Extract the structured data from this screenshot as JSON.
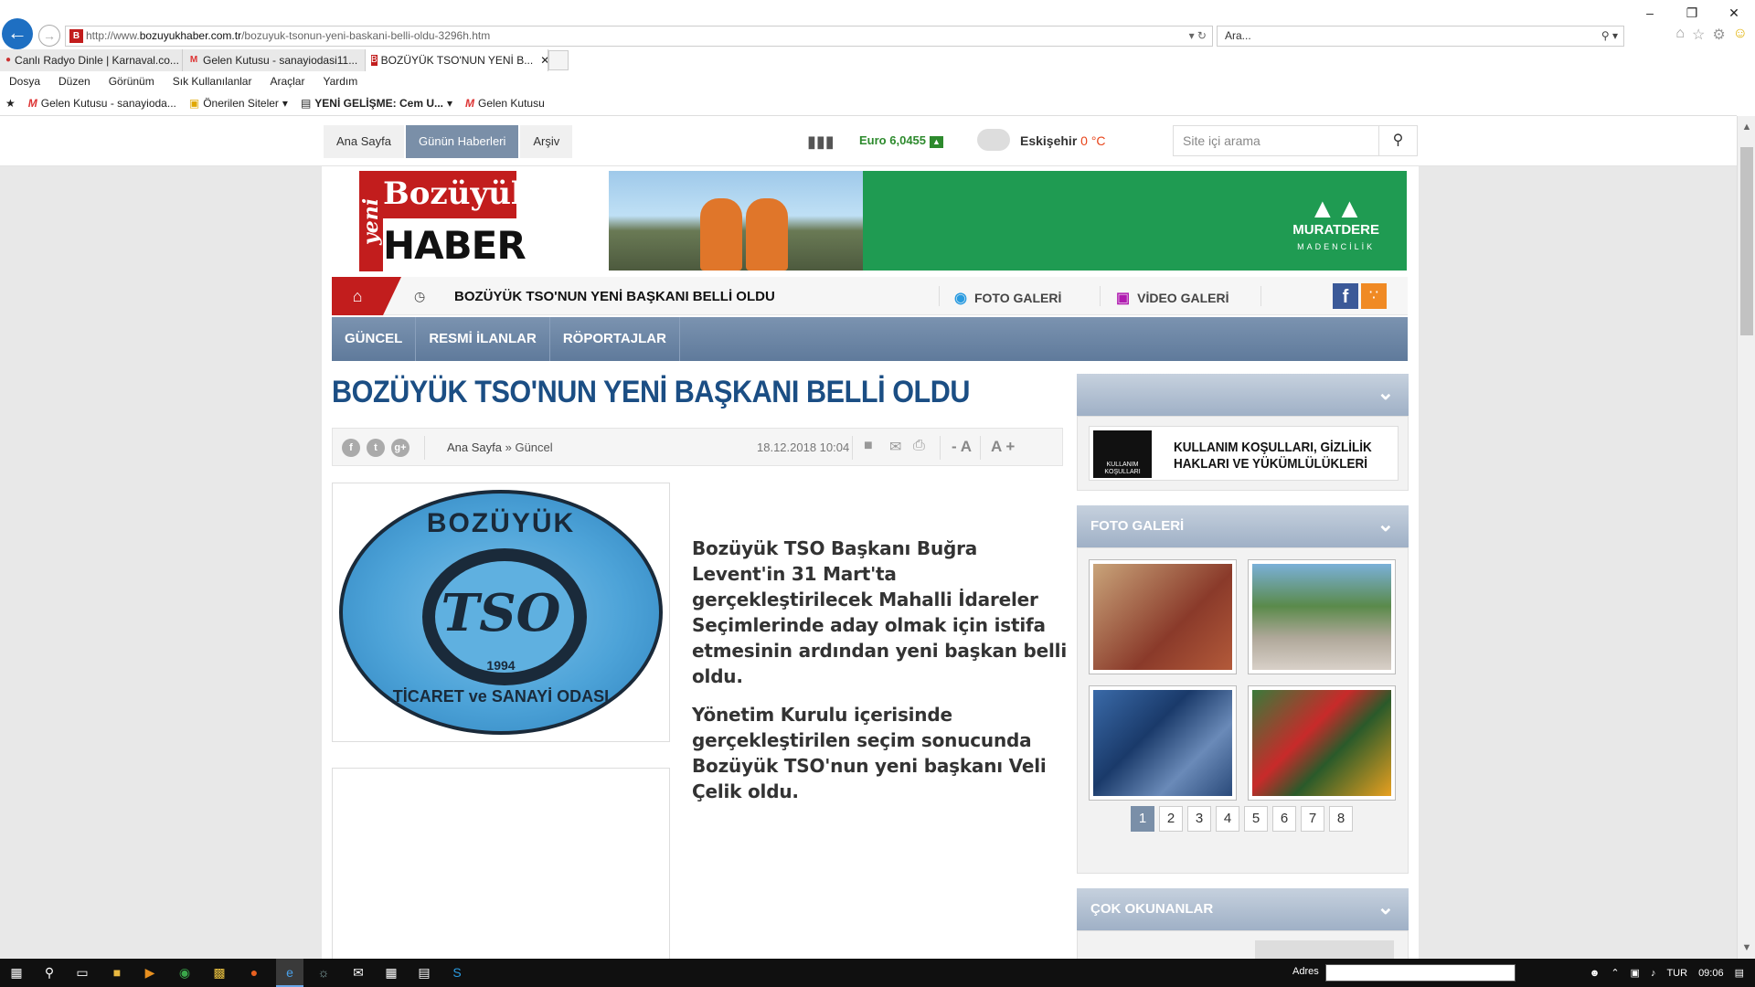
{
  "browser": {
    "url_prefix": "http://www.",
    "url_host": "bozuyukhaber.com.tr",
    "url_path": "/bozuyuk-tsonun-yeni-baskani-belli-oldu-3296h.htm",
    "search_placeholder": "Ara...",
    "tabs": [
      {
        "label": "Canlı Radyo Dinle | Karnaval.co..."
      },
      {
        "label": "Gelen Kutusu - sanayiodasi11..."
      },
      {
        "label": "BOZÜYÜK TSO'NUN YENİ B..."
      }
    ],
    "menu": [
      "Dosya",
      "Düzen",
      "Görünüm",
      "Sık Kullanılanlar",
      "Araçlar",
      "Yardım"
    ],
    "favorites": [
      "Gelen Kutusu - sanayioda...",
      "Önerilen Siteler",
      "YENİ GELİŞME: Cem U...",
      "Gelen Kutusu"
    ]
  },
  "topbar": {
    "nav": [
      "Ana Sayfa",
      "Günün Haberleri",
      "Arşiv"
    ],
    "euro_label": "Euro",
    "euro_value": "6,0455",
    "city": "Eskişehir",
    "temp": "0 °C",
    "search_placeholder": "Site içi arama"
  },
  "logo": {
    "yeni": "yeni",
    "line1": "Bozüyük",
    "line2": "HABER"
  },
  "banner": {
    "brand": "MURATDERE",
    "sub": "MADENCİLİK"
  },
  "newsbar": {
    "ticker": "BOZÜYÜK TSO'NUN YENİ BAŞKANI BELLİ OLDU",
    "foto": "FOTO GALERİ",
    "video": "VİDEO GALERİ"
  },
  "categories": [
    "GÜNCEL",
    "RESMİ İLANLAR",
    "RÖPORTAJLAR"
  ],
  "article": {
    "title": "BOZÜYÜK TSO'NUN YENİ BAŞKANI BELLİ OLDU",
    "crumb_home": "Ana Sayfa",
    "crumb_cat": "» Güncel",
    "date": "18.12.2018 10:04",
    "font_minus": "- A",
    "font_plus": "A +",
    "image_seal": {
      "top": "BOZÜYÜK",
      "center": "TSO",
      "year": "1994",
      "bottom": "TİCARET ve SANAYİ ODASI"
    },
    "paragraphs": [
      "Bozüyük TSO Başkanı Buğra Levent'in 31 Mart'ta gerçekleştirilecek Mahalli İdareler Seçimlerinde aday olmak için istifa etmesinin ardından yeni başkan belli oldu.",
      "Yönetim Kurulu içerisinde gerçekleştirilen seçim sonucunda Bozüyük TSO'nun yeni başkanı Veli Çelik oldu."
    ]
  },
  "sidebar": {
    "kk_icon_text": "KULLANIM KOŞULLARI",
    "kk_text_1": "KULLANIM KOŞULLARI, GİZLİLİK",
    "kk_text_2": "HAKLARI VE YÜKÜMLÜLÜKLERİ",
    "foto_title": "FOTO GALERİ",
    "pages": [
      "1",
      "2",
      "3",
      "4",
      "5",
      "6",
      "7",
      "8"
    ],
    "cok_title": "ÇOK OKUNANLAR"
  },
  "taskbar": {
    "adres": "Adres",
    "lang": "TUR",
    "time": "09:06"
  }
}
